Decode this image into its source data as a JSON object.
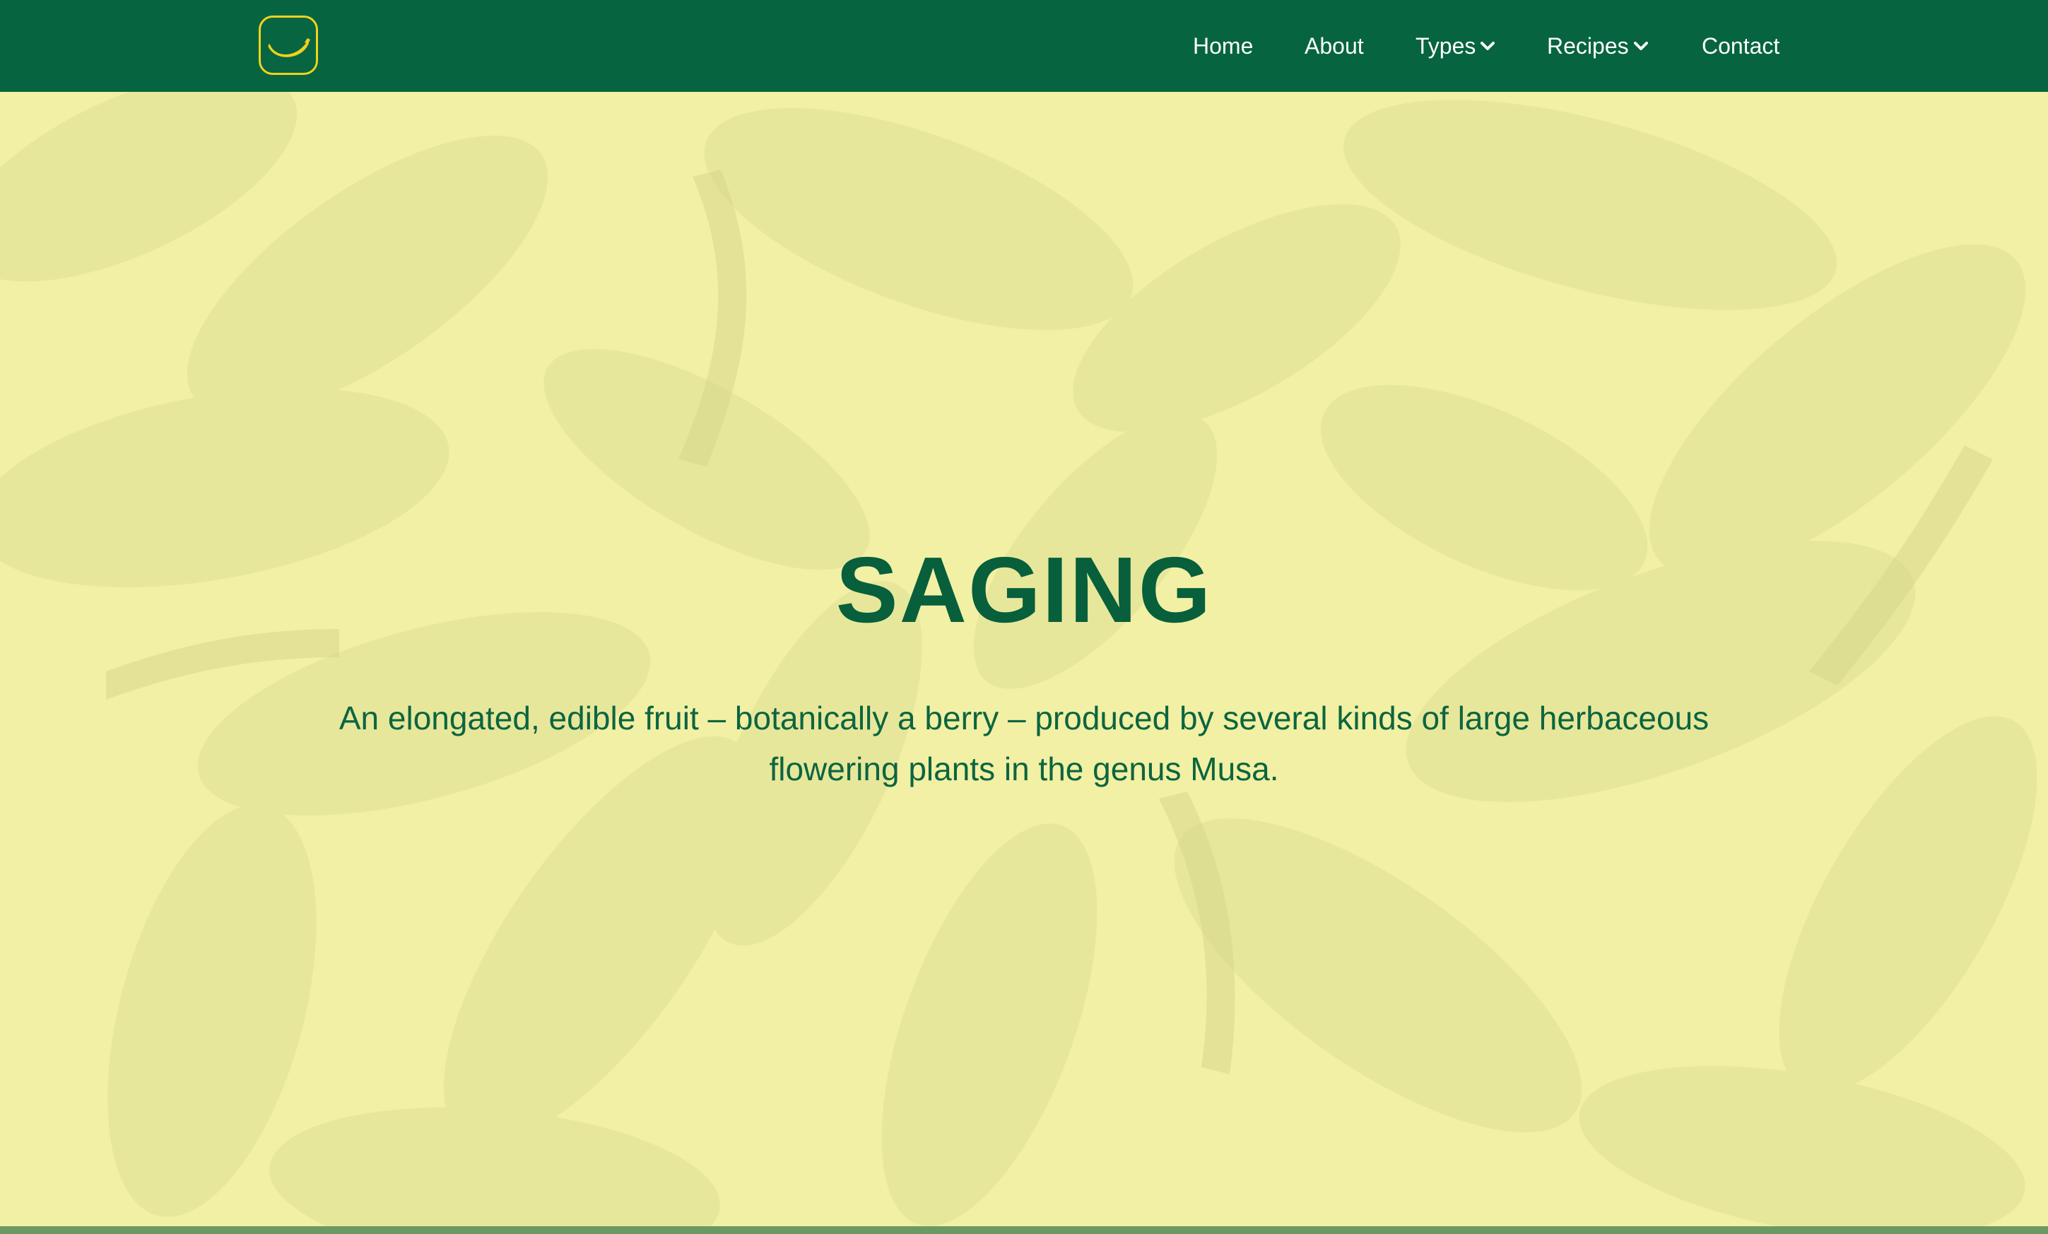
{
  "colors": {
    "nav_background": "#076440",
    "accent_yellow": "#f1d21b",
    "hero_overlay": "#f4f2ab",
    "heading_green": "#075f3c"
  },
  "logo": {
    "icon": "banana-icon"
  },
  "nav": {
    "home": "Home",
    "about": "About",
    "types": "Types",
    "recipes": "Recipes",
    "contact": "Contact",
    "dropdown_icon": "chevron-down-icon"
  },
  "hero": {
    "title": "SAGING",
    "subtitle": "An elongated, edible fruit – botanically a berry – produced by several kinds of large herbaceous flowering plants in the genus Musa."
  }
}
